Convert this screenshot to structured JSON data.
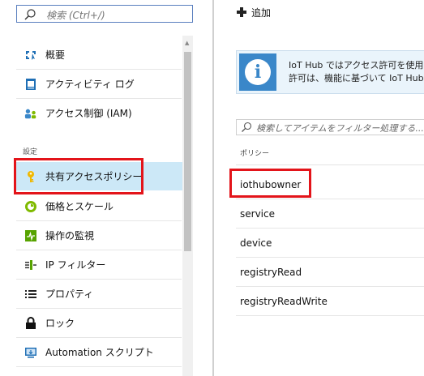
{
  "sidebar": {
    "search_placeholder": "検索 (Ctrl+/)",
    "items": [
      {
        "label": "概要",
        "icon": "overview-icon"
      },
      {
        "label": "アクティビティ ログ",
        "icon": "activity-log-icon"
      },
      {
        "label": "アクセス制御 (IAM)",
        "icon": "access-control-icon"
      }
    ],
    "section_label": "設定",
    "settings_items": [
      {
        "label": "共有アクセスポリシー",
        "icon": "key-icon",
        "selected": true
      },
      {
        "label": "価格とスケール",
        "icon": "pricing-icon"
      },
      {
        "label": "操作の監視",
        "icon": "monitoring-icon"
      },
      {
        "label": "IP フィルター",
        "icon": "ip-filter-icon"
      },
      {
        "label": "プロパティ",
        "icon": "properties-icon"
      },
      {
        "label": "ロック",
        "icon": "lock-icon"
      },
      {
        "label": "Automation スクリプト",
        "icon": "automation-script-icon"
      }
    ]
  },
  "toolbar": {
    "add_label": "追加"
  },
  "info_banner": {
    "line1": "IoT Hub ではアクセス許可を使用し",
    "line2": "許可は、機能に基づいて IoT Hub"
  },
  "filter": {
    "placeholder": "検索してアイテムをフィルター処理する..."
  },
  "policies": {
    "column_header": "ポリシー",
    "rows": [
      "iothubowner",
      "service",
      "device",
      "registryRead",
      "registryReadWrite"
    ]
  },
  "colors": {
    "selected_bg": "#cce8f7",
    "highlight_border": "#e3141a",
    "info_icon_bg": "#3a87c9",
    "search_border": "#5a7fbf"
  }
}
